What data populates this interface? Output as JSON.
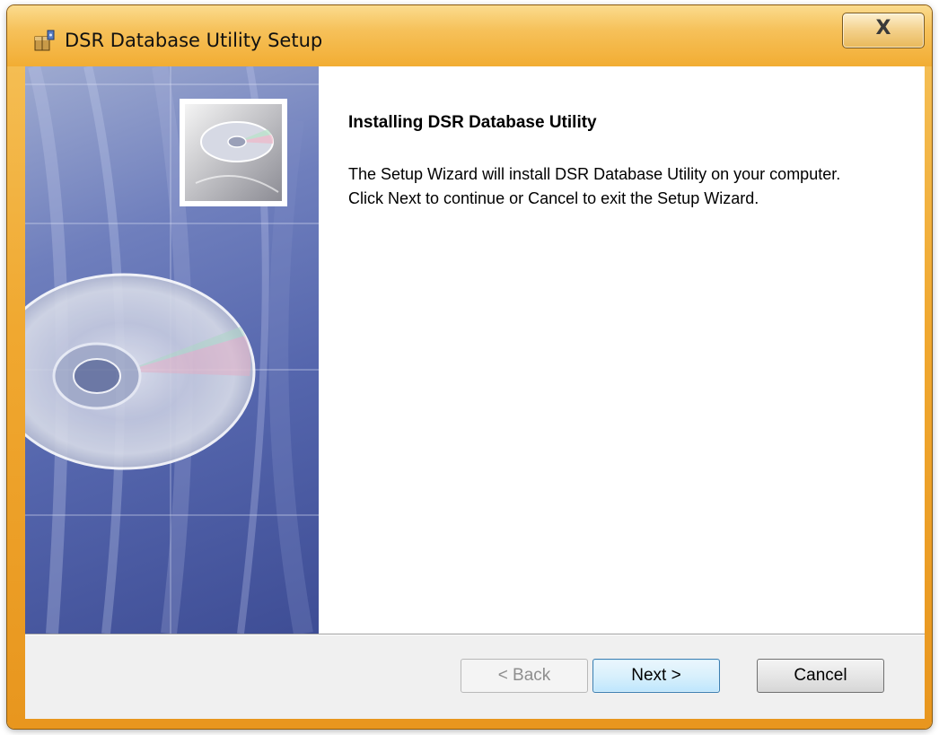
{
  "window": {
    "title": "DSR Database Utility Setup",
    "close_glyph": "X"
  },
  "content": {
    "heading": "Installing DSR Database Utility",
    "body": "The Setup Wizard will install DSR Database Utility on your computer.  Click Next to continue or Cancel to exit the Setup Wizard."
  },
  "buttons": {
    "back": "< Back",
    "next": "Next >",
    "cancel": "Cancel"
  },
  "icons": {
    "title": "installer-box-icon",
    "banner": "cd-disc-banner"
  },
  "colors": {
    "titlebar": "#f2ad33",
    "banner": "#5566ad",
    "next_border": "#3c7fb1"
  }
}
